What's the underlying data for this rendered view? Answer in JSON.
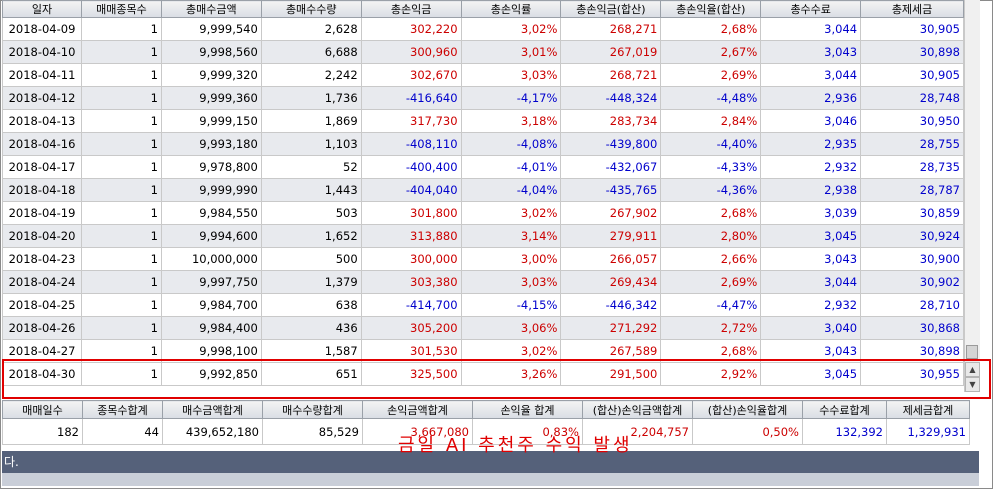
{
  "columns": [
    "일자",
    "매매종목수",
    "총매수금액",
    "총매수수량",
    "총손익금",
    "총손익률",
    "총손익금(합산)",
    "총손익율(합산)",
    "총수수료",
    "총제세금"
  ],
  "rows": [
    {
      "date": "2018-04-09",
      "count": "1",
      "buy_amount": "9,999,540",
      "buy_qty": "2,628",
      "pnl": "302,220",
      "pnl_rate": "3,02%",
      "pnl_sum": "268,271",
      "pnl_rate_sum": "2,68%",
      "fee": "3,044",
      "tax": "30,905"
    },
    {
      "date": "2018-04-10",
      "count": "1",
      "buy_amount": "9,998,560",
      "buy_qty": "6,688",
      "pnl": "300,960",
      "pnl_rate": "3,01%",
      "pnl_sum": "267,019",
      "pnl_rate_sum": "2,67%",
      "fee": "3,043",
      "tax": "30,898"
    },
    {
      "date": "2018-04-11",
      "count": "1",
      "buy_amount": "9,999,320",
      "buy_qty": "2,242",
      "pnl": "302,670",
      "pnl_rate": "3,03%",
      "pnl_sum": "268,721",
      "pnl_rate_sum": "2,69%",
      "fee": "3,044",
      "tax": "30,905"
    },
    {
      "date": "2018-04-12",
      "count": "1",
      "buy_amount": "9,999,360",
      "buy_qty": "1,736",
      "pnl": "-416,640",
      "pnl_rate": "-4,17%",
      "pnl_sum": "-448,324",
      "pnl_rate_sum": "-4,48%",
      "fee": "2,936",
      "tax": "28,748"
    },
    {
      "date": "2018-04-13",
      "count": "1",
      "buy_amount": "9,999,150",
      "buy_qty": "1,869",
      "pnl": "317,730",
      "pnl_rate": "3,18%",
      "pnl_sum": "283,734",
      "pnl_rate_sum": "2,84%",
      "fee": "3,046",
      "tax": "30,950"
    },
    {
      "date": "2018-04-16",
      "count": "1",
      "buy_amount": "9,993,180",
      "buy_qty": "1,103",
      "pnl": "-408,110",
      "pnl_rate": "-4,08%",
      "pnl_sum": "-439,800",
      "pnl_rate_sum": "-4,40%",
      "fee": "2,935",
      "tax": "28,755"
    },
    {
      "date": "2018-04-17",
      "count": "1",
      "buy_amount": "9,978,800",
      "buy_qty": "52",
      "pnl": "-400,400",
      "pnl_rate": "-4,01%",
      "pnl_sum": "-432,067",
      "pnl_rate_sum": "-4,33%",
      "fee": "2,932",
      "tax": "28,735"
    },
    {
      "date": "2018-04-18",
      "count": "1",
      "buy_amount": "9,999,990",
      "buy_qty": "1,443",
      "pnl": "-404,040",
      "pnl_rate": "-4,04%",
      "pnl_sum": "-435,765",
      "pnl_rate_sum": "-4,36%",
      "fee": "2,938",
      "tax": "28,787"
    },
    {
      "date": "2018-04-19",
      "count": "1",
      "buy_amount": "9,984,550",
      "buy_qty": "503",
      "pnl": "301,800",
      "pnl_rate": "3,02%",
      "pnl_sum": "267,902",
      "pnl_rate_sum": "2,68%",
      "fee": "3,039",
      "tax": "30,859"
    },
    {
      "date": "2018-04-20",
      "count": "1",
      "buy_amount": "9,994,600",
      "buy_qty": "1,652",
      "pnl": "313,880",
      "pnl_rate": "3,14%",
      "pnl_sum": "279,911",
      "pnl_rate_sum": "2,80%",
      "fee": "3,045",
      "tax": "30,924"
    },
    {
      "date": "2018-04-23",
      "count": "1",
      "buy_amount": "10,000,000",
      "buy_qty": "500",
      "pnl": "300,000",
      "pnl_rate": "3,00%",
      "pnl_sum": "266,057",
      "pnl_rate_sum": "2,66%",
      "fee": "3,043",
      "tax": "30,900"
    },
    {
      "date": "2018-04-24",
      "count": "1",
      "buy_amount": "9,997,750",
      "buy_qty": "1,379",
      "pnl": "303,380",
      "pnl_rate": "3,03%",
      "pnl_sum": "269,434",
      "pnl_rate_sum": "2,69%",
      "fee": "3,044",
      "tax": "30,902"
    },
    {
      "date": "2018-04-25",
      "count": "1",
      "buy_amount": "9,984,700",
      "buy_qty": "638",
      "pnl": "-414,700",
      "pnl_rate": "-4,15%",
      "pnl_sum": "-446,342",
      "pnl_rate_sum": "-4,47%",
      "fee": "2,932",
      "tax": "28,710"
    },
    {
      "date": "2018-04-26",
      "count": "1",
      "buy_amount": "9,984,400",
      "buy_qty": "436",
      "pnl": "305,200",
      "pnl_rate": "3,06%",
      "pnl_sum": "271,292",
      "pnl_rate_sum": "2,72%",
      "fee": "3,040",
      "tax": "30,868"
    },
    {
      "date": "2018-04-27",
      "count": "1",
      "buy_amount": "9,998,100",
      "buy_qty": "1,587",
      "pnl": "301,530",
      "pnl_rate": "3,02%",
      "pnl_sum": "267,589",
      "pnl_rate_sum": "2,68%",
      "fee": "3,043",
      "tax": "30,898"
    },
    {
      "date": "2018-04-30",
      "count": "1",
      "buy_amount": "9,992,850",
      "buy_qty": "651",
      "pnl": "325,500",
      "pnl_rate": "3,26%",
      "pnl_sum": "291,500",
      "pnl_rate_sum": "2,92%",
      "fee": "3,045",
      "tax": "30,955"
    }
  ],
  "summary": {
    "headers": [
      "매매일수",
      "종목수합계",
      "매수금액합계",
      "매수수량합계",
      "손익금액합계",
      "손익율 합계",
      "(합산)손익금액합계",
      "(합산)손익율합계",
      "수수료합계",
      "제세금합계"
    ],
    "values": [
      "182",
      "44",
      "439,652,180",
      "85,529",
      "3,667,080",
      "0,83%",
      "2,204,757",
      "0,50%",
      "132,392",
      "1,329,931"
    ]
  },
  "status_text": "다.",
  "overlay_text": "금일 AI 추천주 수익 발생",
  "colors": {
    "positive": "#cc0000",
    "negative": "#0000cc",
    "highlight": "#e00000",
    "status_bar": "#55617a"
  },
  "icons": {
    "scroll_up": "scroll-up-arrow-icon",
    "scroll_down": "scroll-down-arrow-icon"
  }
}
